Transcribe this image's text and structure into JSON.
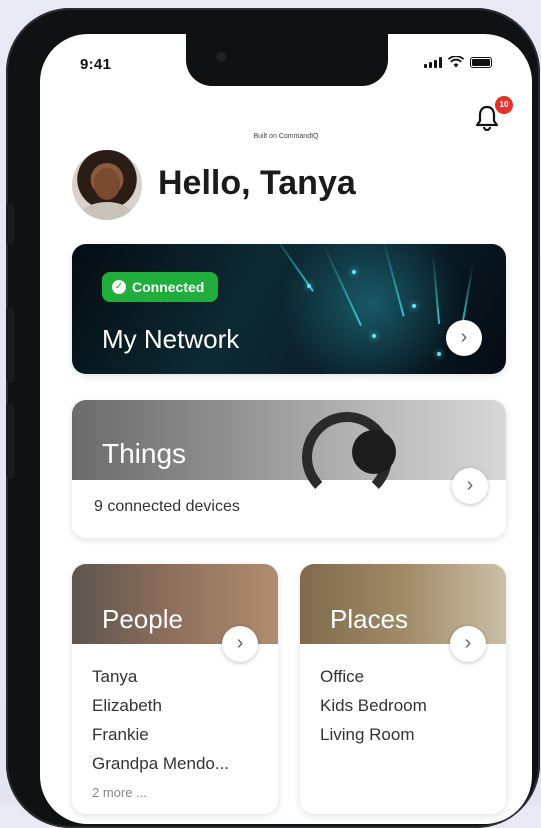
{
  "status_bar": {
    "time": "9:41"
  },
  "header": {
    "built_on": "Built on CommandIQ",
    "notification_count": "10",
    "greeting": "Hello, Tanya"
  },
  "network_card": {
    "badge": "Connected",
    "title": "My Network"
  },
  "things_card": {
    "title": "Things",
    "subtitle": "9 connected devices"
  },
  "people_card": {
    "title": "People",
    "items": [
      "Tanya",
      "Elizabeth",
      "Frankie",
      "Grandpa Mendo..."
    ],
    "more": "2 more ..."
  },
  "places_card": {
    "title": "Places",
    "items": [
      "Office",
      "Kids Bedroom",
      "Living Room"
    ]
  },
  "colors": {
    "connected_green": "#1fae3b",
    "badge_red": "#e53227",
    "text_dark": "#1b1b1b"
  },
  "icons": {
    "notification": "bell-icon",
    "chevron": "chevron-right-icon",
    "check": "check-icon"
  }
}
